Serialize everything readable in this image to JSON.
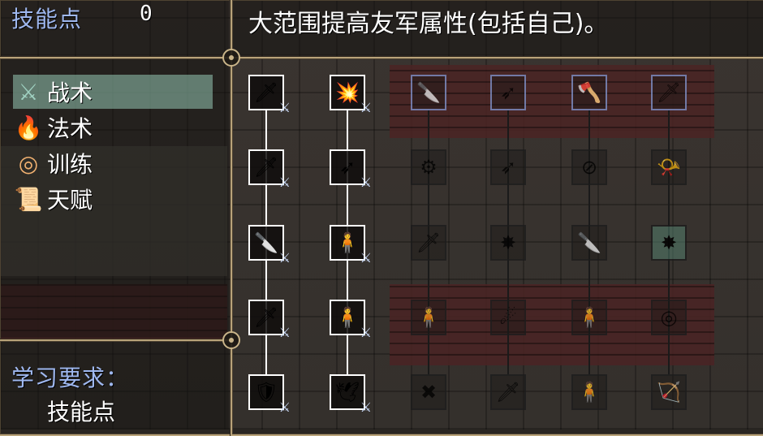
{
  "header": {
    "skill_points_label": "技能点",
    "skill_points_value": "0",
    "description": "大范围提高友军属性(包括自己)。"
  },
  "categories": [
    {
      "label": "战术",
      "icon": "tactics-icon",
      "glyph": "⚔",
      "color": "#9fd0c0",
      "active": true
    },
    {
      "label": "法术",
      "icon": "fire-icon",
      "glyph": "🔥",
      "color": "#ff8a1a",
      "active": false
    },
    {
      "label": "训练",
      "icon": "target-icon",
      "glyph": "◎",
      "color": "#f0b070",
      "active": false
    },
    {
      "label": "天赋",
      "icon": "scroll-icon",
      "glyph": "📜",
      "color": "#e8c890",
      "active": false
    }
  ],
  "requirements": {
    "title": "学习要求：",
    "item": "技能点"
  },
  "colors": {
    "label_blue": "#9fb8f0",
    "frame_gold": "#b9a37a",
    "active_row": "#96c8b4"
  },
  "skill_tree": {
    "columns": [
      {
        "unlocked": true,
        "skills": [
          {
            "icon": "sword-icon",
            "glyph": "🗡"
          },
          {
            "icon": "flaming-sword-icon",
            "glyph": "🗡"
          },
          {
            "icon": "fire-dagger-icon",
            "glyph": "🔪"
          },
          {
            "icon": "ice-sword-icon",
            "glyph": "🗡"
          },
          {
            "icon": "green-shield-icon",
            "glyph": "🛡"
          }
        ]
      },
      {
        "unlocked": true,
        "skills": [
          {
            "icon": "burst-sword-icon",
            "glyph": "💥"
          },
          {
            "icon": "thrust-icon",
            "glyph": "➶"
          },
          {
            "icon": "fire-body-icon",
            "glyph": "🧍"
          },
          {
            "icon": "ice-body-icon",
            "glyph": "🧍"
          },
          {
            "icon": "wing-icon",
            "glyph": "🕊"
          }
        ]
      },
      {
        "unlocked": false,
        "skills": [
          {
            "icon": "fire-dagger-icon",
            "glyph": "🔪"
          },
          {
            "icon": "green-gear-icon",
            "glyph": "⚙"
          },
          {
            "icon": "steel-sword-icon",
            "glyph": "🗡"
          },
          {
            "icon": "fire-figure-icon",
            "glyph": "🧍"
          },
          {
            "icon": "cross-blades-icon",
            "glyph": "✖"
          }
        ]
      },
      {
        "unlocked": false,
        "skills": [
          {
            "icon": "thrust-icon",
            "glyph": "➶"
          },
          {
            "icon": "thrust-icon",
            "glyph": "➶"
          },
          {
            "icon": "fire-burst-icon",
            "glyph": "✸"
          },
          {
            "icon": "shadow-flame-icon",
            "glyph": "☄"
          },
          {
            "icon": "dark-blade-icon",
            "glyph": "🗡"
          }
        ]
      },
      {
        "unlocked": false,
        "skills": [
          {
            "icon": "axe-icon",
            "glyph": "🪓"
          },
          {
            "icon": "no-sword-icon",
            "glyph": "⊘"
          },
          {
            "icon": "fire-dagger-icon",
            "glyph": "🔪"
          },
          {
            "icon": "green-figure-icon",
            "glyph": "🧍"
          },
          {
            "icon": "dark-figure-icon",
            "glyph": "🧍"
          }
        ]
      },
      {
        "unlocked": false,
        "skills": [
          {
            "icon": "golden-blade-icon",
            "glyph": "🗡"
          },
          {
            "icon": "horn-icon",
            "glyph": "📯"
          },
          {
            "icon": "fire-burst-icon",
            "glyph": "✸"
          },
          {
            "icon": "target-arrow-icon",
            "glyph": "◎"
          },
          {
            "icon": "bow-icon",
            "glyph": "🏹"
          }
        ]
      }
    ]
  }
}
